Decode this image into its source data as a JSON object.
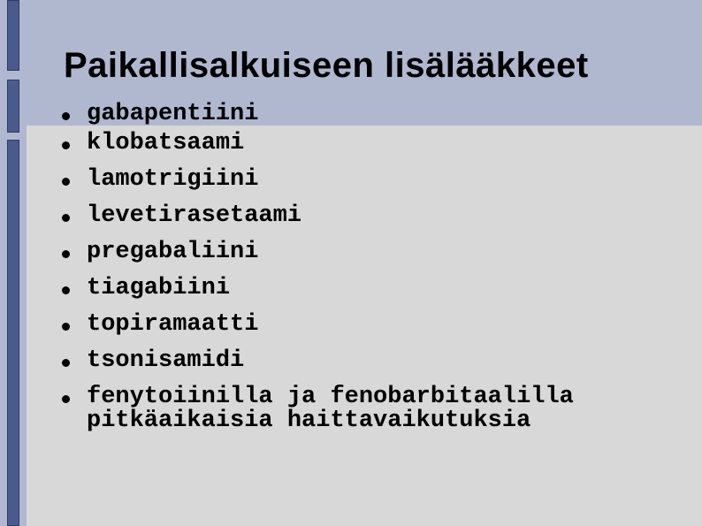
{
  "title": "Paikallisalkuiseen lisälääkkeet",
  "items": [
    "gabapentiini",
    "klobatsaami",
    "lamotrigiini",
    "levetirasetaami",
    "pregabaliini",
    "tiagabiini",
    "topiramaatti",
    "tsonisamidi",
    "fenytoiinilla ja fenobarbitaalilla pitkäaikaisia haittavaikutuksia"
  ]
}
